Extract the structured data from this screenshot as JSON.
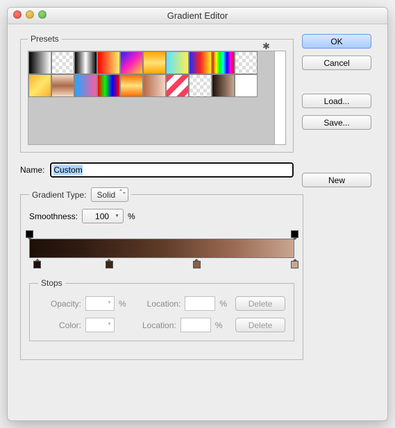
{
  "window": {
    "title": "Gradient Editor"
  },
  "buttons": {
    "ok": "OK",
    "cancel": "Cancel",
    "load": "Load...",
    "save": "Save...",
    "new": "New",
    "delete": "Delete"
  },
  "presets": {
    "legend": "Presets",
    "gear_icon": "gear-icon",
    "row1": [
      "linear-gradient(to right,#000,#fff)",
      "repeating-conic-gradient(#fff 0 25%, #ddd 0 50%) 0 0/10px 10px",
      "linear-gradient(to right,#000,#fff 50%,#000)",
      "linear-gradient(to right,#f00,#ffef6e)",
      "linear-gradient(135deg,#2d1fff,#ff1fbf,#ffd01f)",
      "linear-gradient(180deg,#ffa500,#ffe27a,#ffa500)",
      "linear-gradient(to right,#5de2ff,#fff04d)",
      "linear-gradient(to right,#1b2dff,#ff1f1f,#ffee1f)",
      "linear-gradient(to right,#f00,#ff0,#0f0,#0ff,#00f,#f0f,#f00)",
      "repeating-conic-gradient(#fff 0 25%, #ddd 0 50%) 0 0/10px 10px"
    ],
    "row2": [
      "linear-gradient(135deg,#ffb030,#ffe66b,#ffb030)",
      "linear-gradient(180deg,#f8d9c3,#a86b4a,#f8d9c3)",
      "linear-gradient(to right,#1fa8ff,#ff5aa0)",
      "linear-gradient(to right,#f00,#0f0,#00f,#f00)",
      "linear-gradient(180deg,#ff6a00,#ffe27a,#ff6a00)",
      "linear-gradient(to right,#b86b4a,#f0d4c3)",
      "repeating-linear-gradient(135deg,#ff3b5b 0 8px,#fff 8px 16px)",
      "repeating-conic-gradient(#fff 0 25%, #ddd 0 50%) 0 0/10px 10px",
      "linear-gradient(to right,#1d0f08,#c9a590)",
      "#fff"
    ]
  },
  "name": {
    "label": "Name:",
    "value": "Custom"
  },
  "gradientType": {
    "label": "Gradient Type:",
    "value": "Solid"
  },
  "smoothness": {
    "label": "Smoothness:",
    "value": "100",
    "suffix": "%"
  },
  "chart_data": {
    "type": "gradient",
    "opacity_stops": [
      {
        "location": 0,
        "opacity": 100
      },
      {
        "location": 100,
        "opacity": 100
      }
    ],
    "color_stops": [
      {
        "location": 3,
        "color": "#1d0f08"
      },
      {
        "location": 30,
        "color": "#3e2516"
      },
      {
        "location": 63,
        "color": "#8b5e46"
      },
      {
        "location": 100,
        "color": "#c9a590"
      }
    ]
  },
  "stops": {
    "legend": "Stops",
    "opacityLabel": "Opacity:",
    "colorLabel": "Color:",
    "locationLabel": "Location:",
    "pct": "%"
  }
}
